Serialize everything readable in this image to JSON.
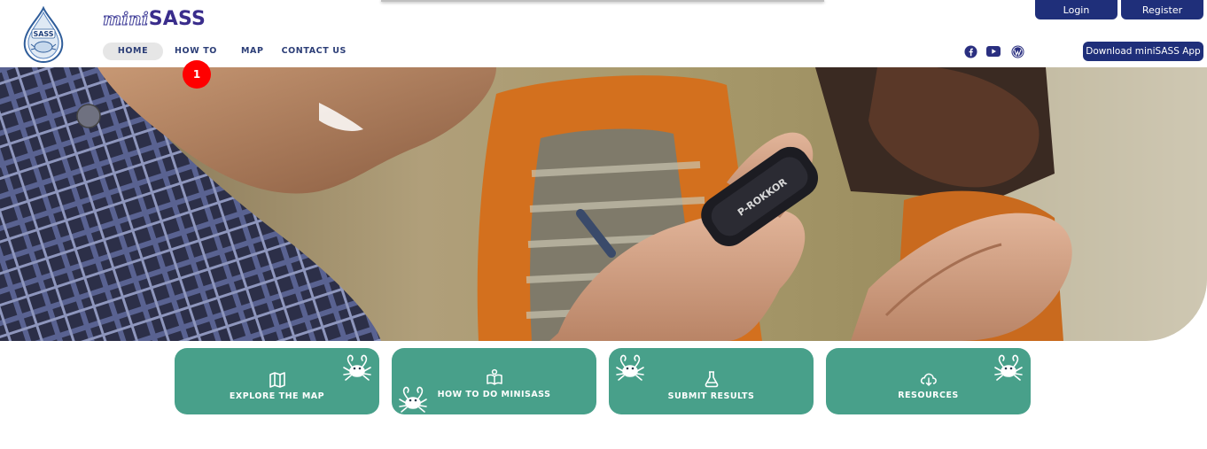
{
  "header": {
    "brand_mini": "mini",
    "brand_sass": "SASS",
    "logo_text": "SASS",
    "nav": {
      "home": "HOME",
      "howto": "HOW TO",
      "map": "MAP",
      "contact": "CONTACT US"
    },
    "badge": "1",
    "social_icons": [
      "facebook-icon",
      "youtube-icon",
      "wordpress-icon"
    ],
    "login_label": "Login",
    "register_label": "Register",
    "download_label": "Download miniSASS App"
  },
  "hero": {
    "caption_on_device": "P-ROKKOR"
  },
  "cards": [
    {
      "label": "EXPLORE THE MAP",
      "icon": "map-icon"
    },
    {
      "label": "HOW TO DO MINISASS",
      "icon": "book-icon"
    },
    {
      "label": "SUBMIT RESULTS",
      "icon": "flask-icon"
    },
    {
      "label": "RESOURCES",
      "icon": "cloud-download-icon"
    }
  ],
  "colors": {
    "nav_text": "#2c3e77",
    "brand": "#3a2d8c",
    "button": "#1f2f7a",
    "card": "#48a08a",
    "badge": "#ff0000"
  }
}
